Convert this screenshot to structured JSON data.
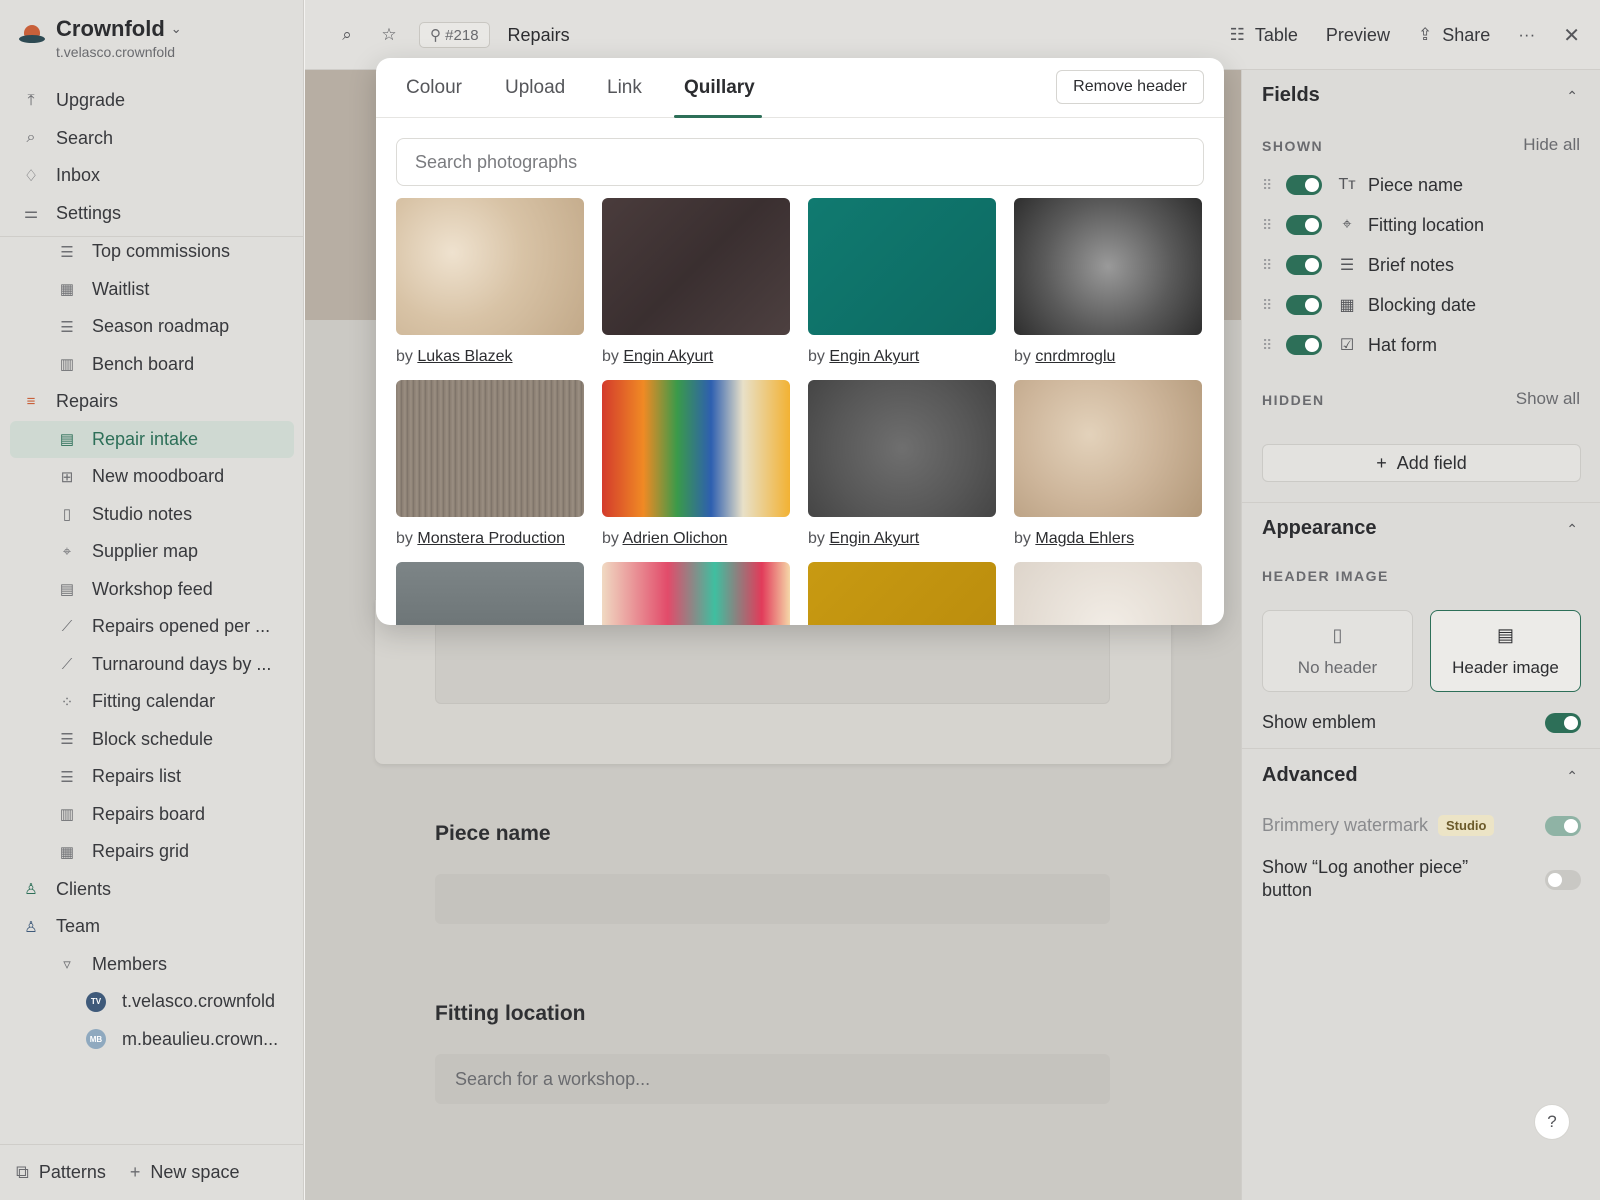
{
  "workspace": {
    "name": "Crownfold",
    "user": "t.velasco.crownfold"
  },
  "nav_top": [
    {
      "label": "Upgrade",
      "icon": "upgrade-icon"
    },
    {
      "label": "Search",
      "icon": "search-icon"
    },
    {
      "label": "Inbox",
      "icon": "bell-icon"
    },
    {
      "label": "Settings",
      "icon": "sliders-icon"
    }
  ],
  "tree": [
    {
      "label": "Top commissions",
      "icon": "list-icon",
      "glyph": "☰",
      "level": 1
    },
    {
      "label": "Waitlist",
      "icon": "grid-icon",
      "glyph": "▦",
      "level": 1
    },
    {
      "label": "Season roadmap",
      "icon": "list-icon",
      "glyph": "☰",
      "level": 1
    },
    {
      "label": "Bench board",
      "icon": "board-icon",
      "glyph": "▥",
      "level": 1
    },
    {
      "label": "Repairs",
      "icon": "repairs-icon",
      "glyph": "≡",
      "level": 0
    },
    {
      "label": "Repair intake",
      "icon": "form-icon",
      "glyph": "▤",
      "level": 1,
      "active": true
    },
    {
      "label": "New moodboard",
      "icon": "moodboard-icon",
      "glyph": "⊞",
      "level": 1
    },
    {
      "label": "Studio notes",
      "icon": "document-icon",
      "glyph": "▯",
      "level": 1
    },
    {
      "label": "Supplier map",
      "icon": "pin-icon",
      "glyph": "⌖",
      "level": 1
    },
    {
      "label": "Workshop feed",
      "icon": "feed-icon",
      "glyph": "▤",
      "level": 1
    },
    {
      "label": "Repairs opened per ...",
      "icon": "line-chart-icon",
      "glyph": "⟋",
      "level": 1
    },
    {
      "label": "Turnaround days by ...",
      "icon": "line-chart-icon",
      "glyph": "⟋",
      "level": 1
    },
    {
      "label": "Fitting calendar",
      "icon": "calendar-grid-icon",
      "glyph": "⁘",
      "level": 1
    },
    {
      "label": "Block schedule",
      "icon": "list-icon",
      "glyph": "☰",
      "level": 1
    },
    {
      "label": "Repairs list",
      "icon": "list-icon",
      "glyph": "☰",
      "level": 1
    },
    {
      "label": "Repairs board",
      "icon": "board-icon",
      "glyph": "▥",
      "level": 1
    },
    {
      "label": "Repairs grid",
      "icon": "grid-icon",
      "glyph": "▦",
      "level": 1
    },
    {
      "label": "Clients",
      "icon": "person-icon",
      "glyph": "♙",
      "level": 0
    },
    {
      "label": "Team",
      "icon": "people-icon",
      "glyph": "♙",
      "level": 0
    },
    {
      "label": "Members",
      "icon": "triangle-down-icon",
      "glyph": "▿",
      "level": 1
    },
    {
      "label": "t.velasco.crownfold",
      "avatar": "TV",
      "avatar_color": "#3f5a7a",
      "level": 2
    },
    {
      "label": "m.beaulieu.crown...",
      "avatar": "MB",
      "avatar_color": "#8fa9bf",
      "level": 2
    }
  ],
  "sidebar_bottom": {
    "patterns": "Patterns",
    "new_space": "New space"
  },
  "topbar": {
    "record_id": "#218",
    "title": "Repairs",
    "table": "Table",
    "preview": "Preview",
    "share": "Share"
  },
  "modal": {
    "tabs": [
      "Colour",
      "Upload",
      "Link",
      "Quillary"
    ],
    "active_tab": "Quillary",
    "remove_header": "Remove header",
    "search_placeholder": "Search photographs",
    "by": "by",
    "photos": [
      {
        "author": "Lukas Blazek"
      },
      {
        "author": "Engin Akyurt"
      },
      {
        "author": "Engin Akyurt"
      },
      {
        "author": "cnrdmroglu"
      },
      {
        "author": "Monstera Production"
      },
      {
        "author": "Adrien Olichon"
      },
      {
        "author": "Engin Akyurt"
      },
      {
        "author": "Magda Ehlers"
      },
      {
        "author": ""
      },
      {
        "author": ""
      },
      {
        "author": ""
      },
      {
        "author": ""
      }
    ]
  },
  "form": {
    "fields": [
      {
        "label": "Piece name",
        "placeholder": ""
      },
      {
        "label": "Fitting location",
        "placeholder": "Search for a workshop..."
      }
    ]
  },
  "panel": {
    "fields_title": "Fields",
    "shown": "SHOWN",
    "hide_all": "Hide all",
    "shown_fields": [
      {
        "label": "Piece name",
        "icon": "text-type-icon",
        "glyph": "Tт"
      },
      {
        "label": "Fitting location",
        "icon": "pin-icon",
        "glyph": "⌖"
      },
      {
        "label": "Brief notes",
        "icon": "lines-icon",
        "glyph": "☰"
      },
      {
        "label": "Blocking date",
        "icon": "calendar-icon",
        "glyph": "▦"
      },
      {
        "label": "Hat form",
        "icon": "checkbox-icon",
        "glyph": "☑"
      }
    ],
    "hidden": "HIDDEN",
    "show_all": "Show all",
    "add_field": "Add field",
    "appearance_title": "Appearance",
    "header_image_caps": "HEADER IMAGE",
    "no_header": "No header",
    "header_image": "Header image",
    "show_emblem": "Show emblem",
    "advanced_title": "Advanced",
    "watermark": "Brimmery watermark",
    "studio_badge": "Studio",
    "log_another_line1": "Show “Log another piece”",
    "log_another_line2": "button"
  },
  "colors": {
    "accent": "#2d6f58",
    "sidebar_bg": "#dfdedb",
    "panel_bg": "#dcdbd8"
  }
}
